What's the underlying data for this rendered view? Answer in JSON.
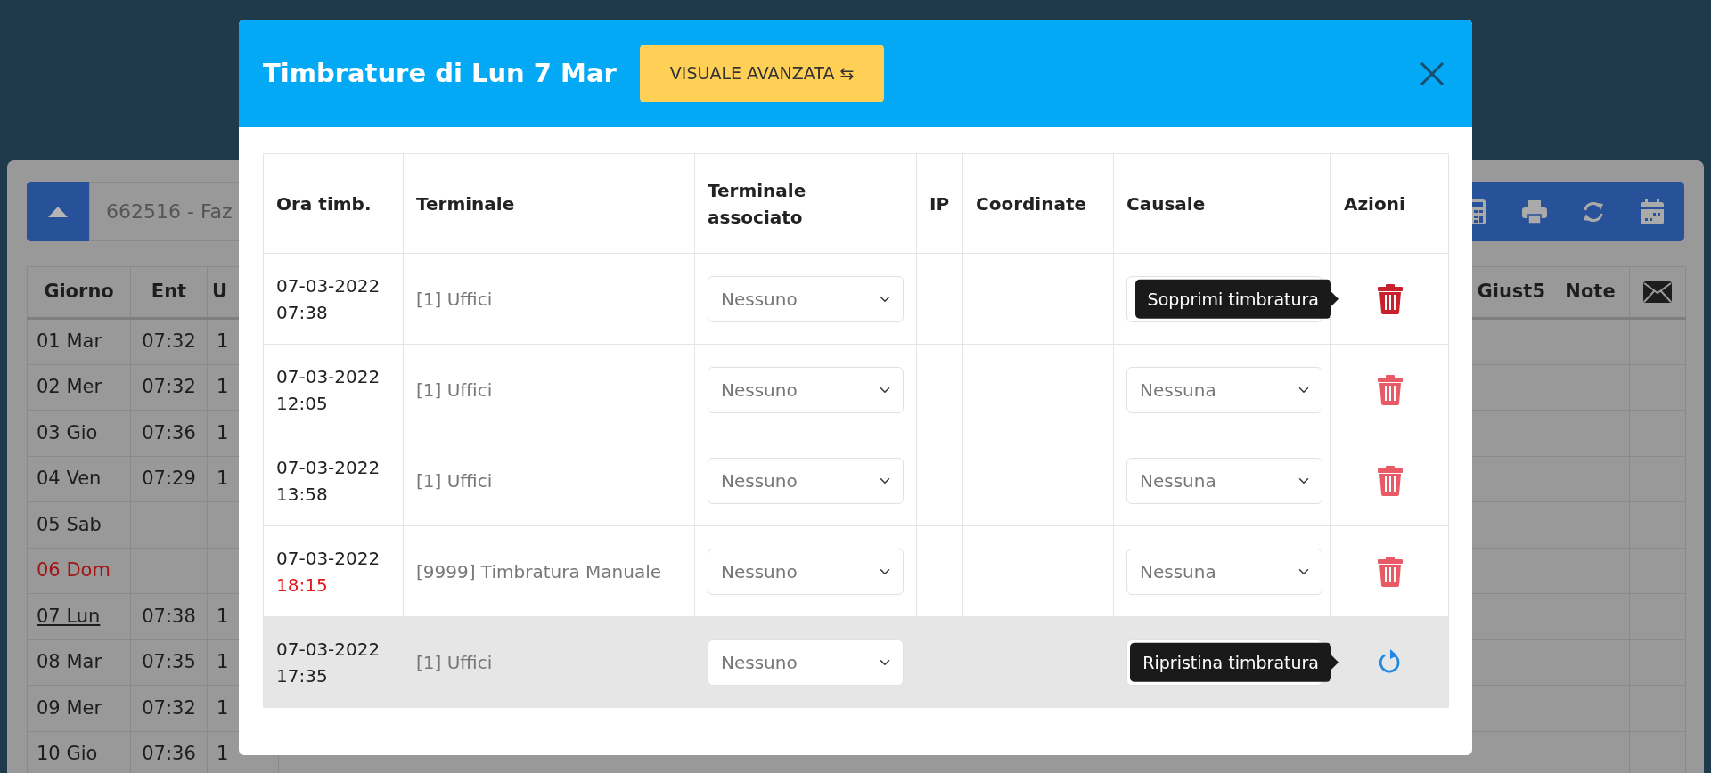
{
  "background": {
    "employee_field": "662516 - Faz",
    "columns": [
      {
        "kind": "text",
        "label": "Giorno"
      },
      {
        "kind": "text",
        "label": "Ent"
      },
      {
        "kind": "text",
        "label": "U"
      },
      {
        "kind": "gap"
      },
      {
        "kind": "text",
        "label": "Giust5"
      },
      {
        "kind": "text",
        "label": "Note"
      },
      {
        "kind": "mail"
      }
    ],
    "rows": [
      {
        "giorno": "01 Mar",
        "ent": "07:32",
        "column_3": "1",
        "holiday": false,
        "selected": false
      },
      {
        "giorno": "02 Mer",
        "ent": "07:32",
        "column_3": "1",
        "holiday": false,
        "selected": false
      },
      {
        "giorno": "03 Gio",
        "ent": "07:36",
        "column_3": "1",
        "holiday": false,
        "selected": false
      },
      {
        "giorno": "04 Ven",
        "ent": "07:29",
        "column_3": "1",
        "holiday": false,
        "selected": false
      },
      {
        "giorno": "05 Sab",
        "holiday": false,
        "selected": false
      },
      {
        "giorno": "06 Dom",
        "holiday": true,
        "selected": false
      },
      {
        "giorno": "07 Lun",
        "ent": "07:38",
        "column_3": "1",
        "holiday": false,
        "selected": true
      },
      {
        "giorno": "08 Mar",
        "ent": "07:35",
        "column_3": "1",
        "holiday": false,
        "selected": false
      },
      {
        "giorno": "09 Mer",
        "ent": "07:32",
        "column_3": "1",
        "holiday": false,
        "selected": false
      },
      {
        "giorno": "10 Gio",
        "ent": "07:36",
        "column_3": "1",
        "holiday": false,
        "selected": false
      }
    ]
  },
  "modal": {
    "title": "Timbrature di Lun 7 Mar",
    "button": "VISUALE AVANZATA ⇆",
    "columns": [
      "Ora timb.",
      "Terminale",
      "Terminale associato",
      "IP",
      "Coordinate",
      "Causale",
      "Azioni"
    ],
    "rows": [
      {
        "date": "07-03-2022",
        "time": "07:38",
        "manual": false,
        "terminal": "[1] Uffici",
        "associated": "Nessuno",
        "deleted": false,
        "hovered": true,
        "tooltip": "Sopprimi timbratura"
      },
      {
        "date": "07-03-2022",
        "time": "12:05",
        "manual": false,
        "terminal": "[1] Uffici",
        "associated": "Nessuno",
        "causale": "Nessuna",
        "deleted": false,
        "hovered": false
      },
      {
        "date": "07-03-2022",
        "time": "13:58",
        "manual": false,
        "terminal": "[1] Uffici",
        "associated": "Nessuno",
        "causale": "Nessuna",
        "deleted": false,
        "hovered": false
      },
      {
        "date": "07-03-2022",
        "time": "18:15",
        "manual": true,
        "terminal": "[9999] Timbratura Manuale",
        "associated": "Nessuno",
        "causale": "Nessuna",
        "deleted": false,
        "hovered": false
      },
      {
        "date": "07-03-2022",
        "time": "17:35",
        "manual": false,
        "terminal": "[1] Uffici",
        "associated": "Nessuno",
        "deleted": true,
        "hovered": true,
        "tooltip": "Ripristina timbratura"
      }
    ]
  }
}
